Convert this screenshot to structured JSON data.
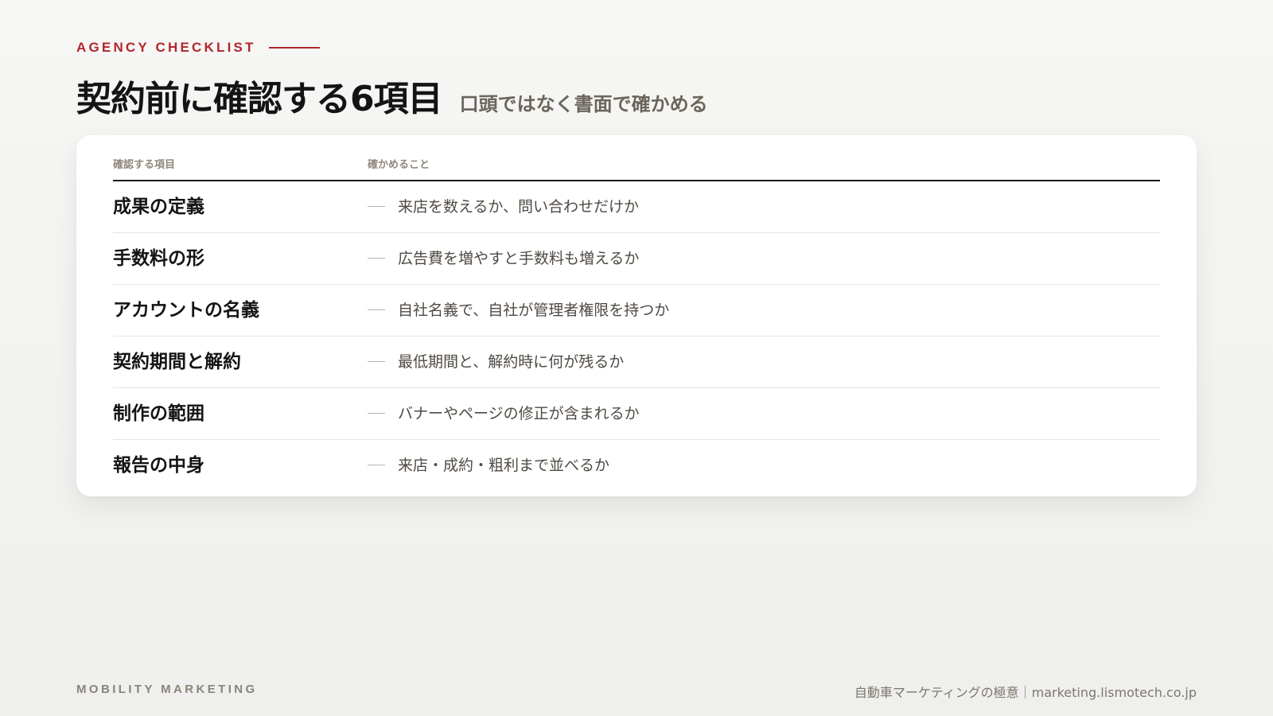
{
  "eyebrow": "AGENCY CHECKLIST",
  "title": "契約前に確認する6項目",
  "subtitle": "口頭ではなく書面で確かめる",
  "table": {
    "col_item": "確認する項目",
    "col_check": "確かめること",
    "rows": [
      {
        "item": "成果の定義",
        "check": "来店を数えるか、問い合わせだけか"
      },
      {
        "item": "手数料の形",
        "check": "広告費を増やすと手数料も増えるか"
      },
      {
        "item": "アカウントの名義",
        "check": "自社名義で、自社が管理者権限を持つか"
      },
      {
        "item": "契約期間と解約",
        "check": "最低期間と、解約時に何が残るか"
      },
      {
        "item": "制作の範囲",
        "check": "バナーやページの修正が含まれるか"
      },
      {
        "item": "報告の中身",
        "check": "来店・成約・粗利まで並べるか"
      }
    ]
  },
  "footer": {
    "brand": "MOBILITY MARKETING",
    "site": "自動車マーケティングの極意｜marketing.lismotech.co.jp"
  },
  "colors": {
    "accent": "#b3262b"
  }
}
